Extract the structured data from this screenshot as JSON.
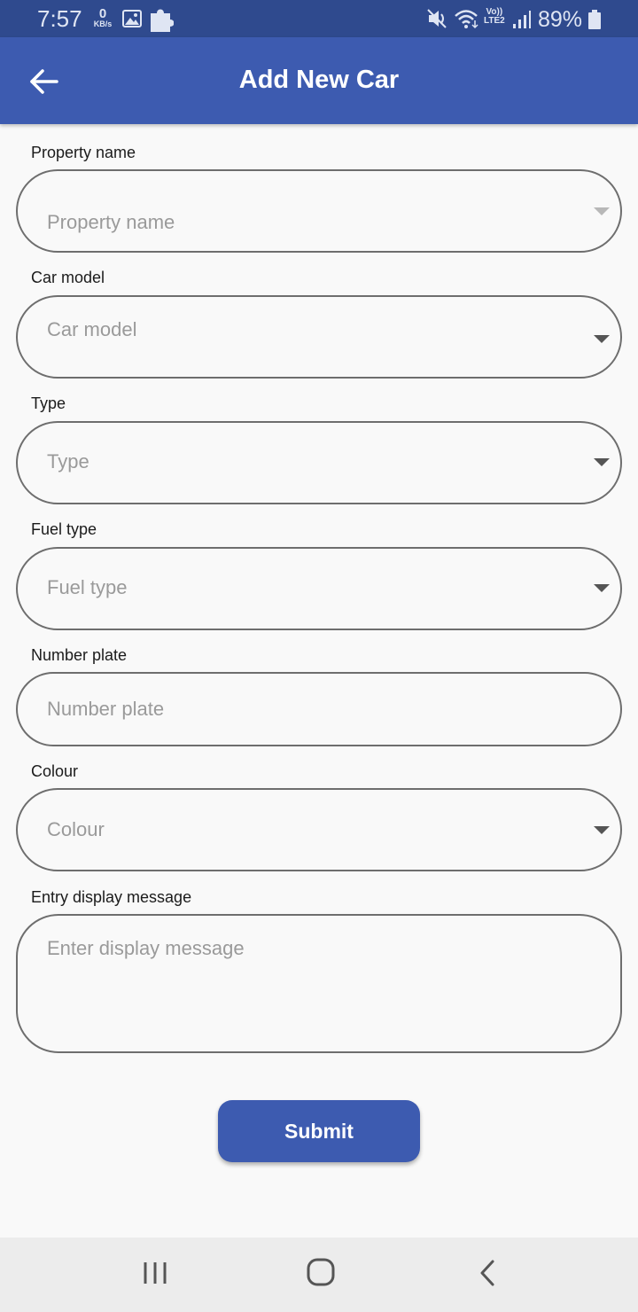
{
  "status_bar": {
    "time": "7:57",
    "net_speed_value": "0",
    "net_speed_unit": "KB/s",
    "lte_top": "Vo))",
    "lte_bottom": "LTE2",
    "battery": "89%",
    "icons": [
      "gallery-icon",
      "puzzle-icon",
      "mute-icon",
      "wifi-icon",
      "signal-icon",
      "battery-icon"
    ]
  },
  "app_bar": {
    "title": "Add New Car",
    "back_icon": "arrow-left-icon",
    "color": "#3d5bb0"
  },
  "form": {
    "property_name": {
      "label": "Property name",
      "placeholder": "Property name",
      "type": "dropdown"
    },
    "car_model": {
      "label": "Car model",
      "placeholder": "Car model",
      "type": "dropdown"
    },
    "type": {
      "label": "Type",
      "placeholder": "Type",
      "type": "dropdown"
    },
    "fuel_type": {
      "label": "Fuel type",
      "placeholder": "Fuel type",
      "type": "dropdown"
    },
    "number_plate": {
      "label": "Number plate",
      "placeholder": "Number plate",
      "type": "text"
    },
    "colour": {
      "label": "Colour",
      "placeholder": "Colour",
      "type": "dropdown"
    },
    "entry_display_message": {
      "label": "Entry display message",
      "placeholder": "Enter display message",
      "type": "textarea"
    }
  },
  "submit_label": "Submit",
  "nav_bar": {
    "icons": [
      "recents-icon",
      "home-icon",
      "back-icon"
    ]
  }
}
